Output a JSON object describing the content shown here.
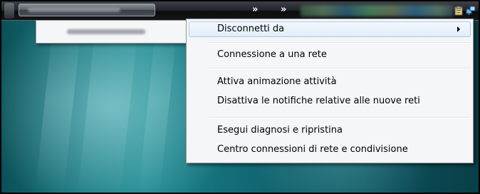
{
  "taskbar": {
    "chevrons": [
      "»",
      "»"
    ],
    "tray_icons": [
      "clipboard-icon",
      "network-monitors-icon"
    ]
  },
  "context_menu": {
    "items": [
      {
        "label": "Disconnetti da",
        "has_submenu": true,
        "highlighted": true
      },
      {
        "label": "Connessione a una rete"
      },
      {
        "label": "Attiva animazione attività"
      },
      {
        "label": "Disattiva le notifiche relative alle nuove reti"
      },
      {
        "label": "Esegui diagnosi e ripristina"
      },
      {
        "label": "Centro connessioni di rete e condivisione"
      }
    ]
  },
  "colors": {
    "menu_background": "#f5f6f7",
    "highlight_border": "#a9c8ed",
    "desktop_teal": "#1a7a82"
  }
}
